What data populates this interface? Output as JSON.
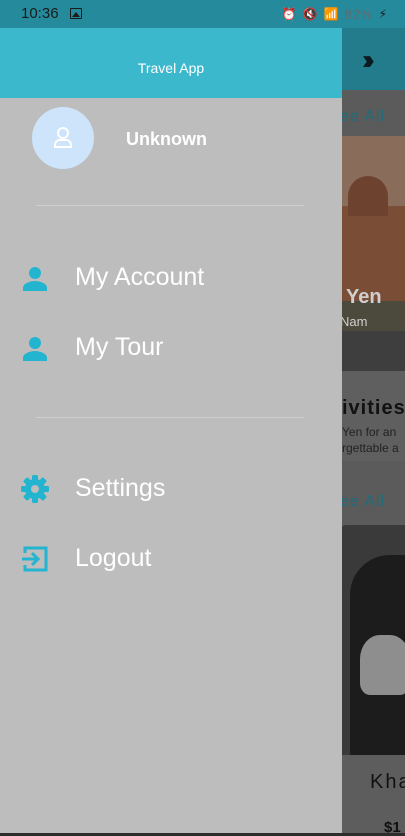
{
  "status_bar": {
    "time": "10:36",
    "battery_text": "82%"
  },
  "drawer": {
    "title": "Travel App",
    "user": {
      "name": "Unknown"
    },
    "menu": [
      {
        "label": "My Account",
        "icon": "person-icon"
      },
      {
        "label": "My Tour",
        "icon": "person-icon"
      },
      {
        "label": "Settings",
        "icon": "gear-icon"
      },
      {
        "label": "Logout",
        "icon": "logout-icon"
      }
    ]
  },
  "background_app": {
    "see_all_1": "ee All",
    "see_all_2": "ee All",
    "card_title": "Yen",
    "card_subtitle": "Nam",
    "activities_heading": "ivities",
    "activities_line1": "Yen for an",
    "activities_line2": "rgettable a",
    "bottom_title": "Kha",
    "bottom_price": "$1"
  },
  "colors": {
    "accent": "#3bb8cc",
    "drawer_bg": "#bdbdbd",
    "icon_color": "#23b4cf"
  }
}
